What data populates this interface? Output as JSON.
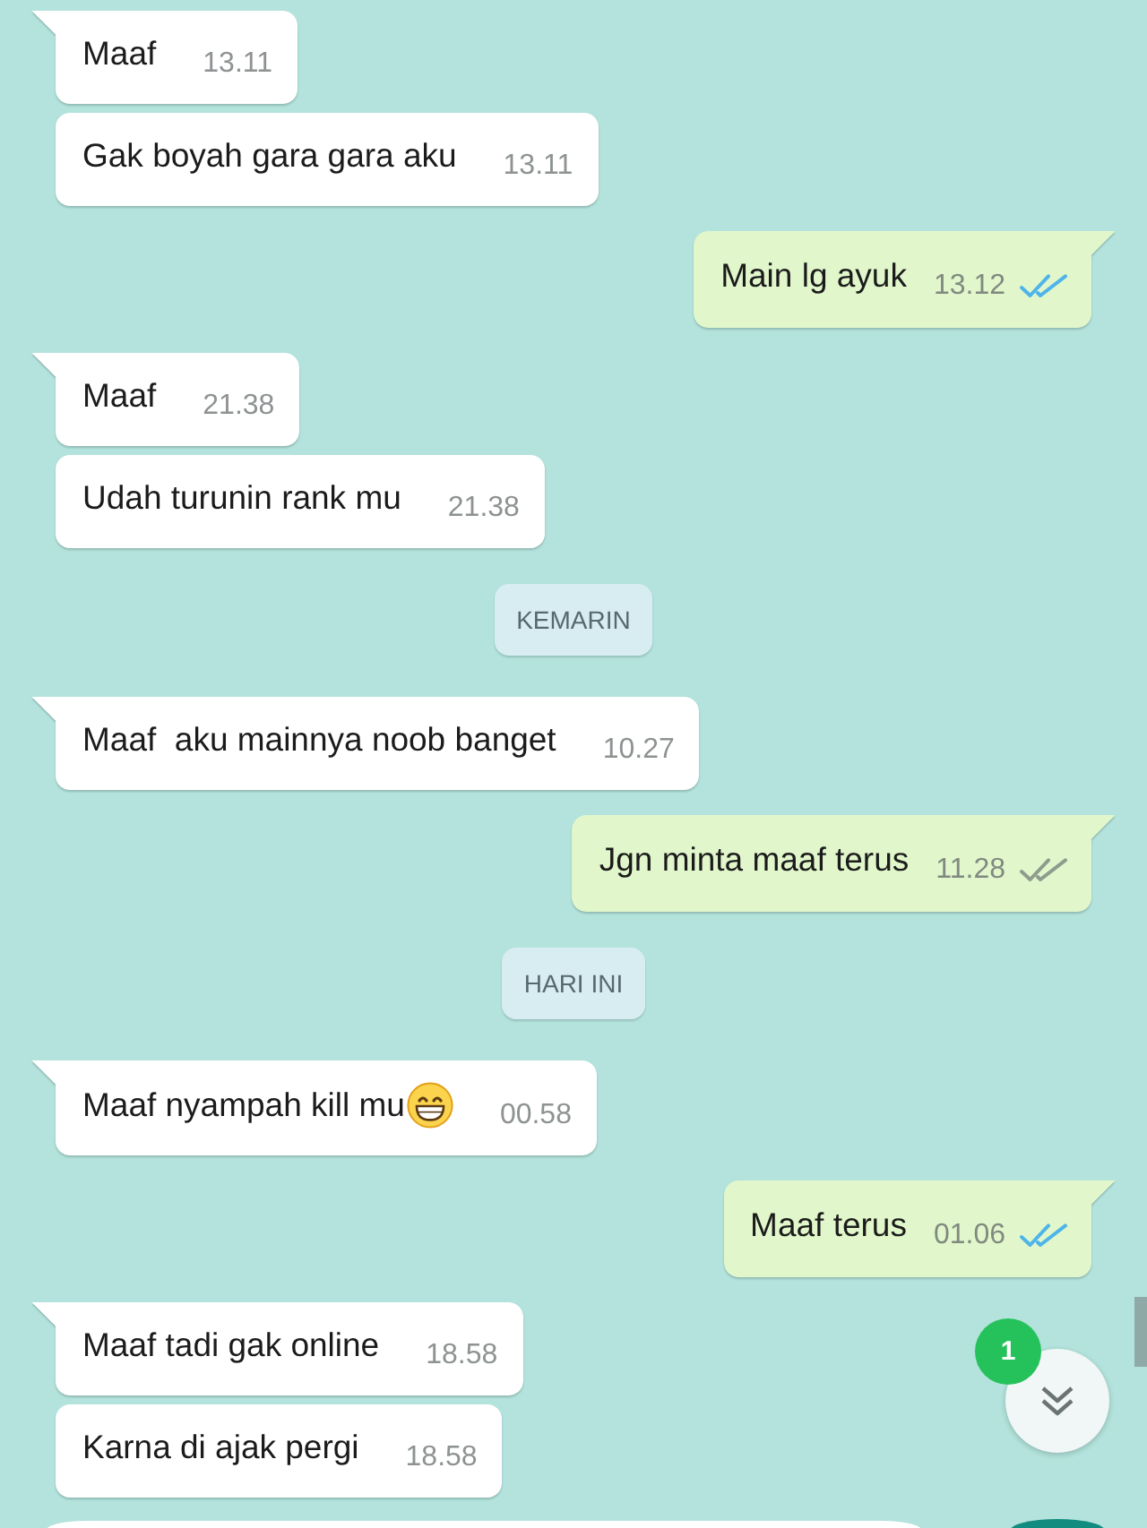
{
  "messages": [
    {
      "kind": "message",
      "outgoing": false,
      "tail": true,
      "text": "Maaf",
      "time": "13.11"
    },
    {
      "kind": "message",
      "outgoing": false,
      "tail": false,
      "text": "Gak boyah gara gara aku",
      "time": "13.11"
    },
    {
      "kind": "message",
      "outgoing": true,
      "tail": true,
      "text": "Main lg ayuk",
      "time": "13.12",
      "read": true
    },
    {
      "kind": "message",
      "outgoing": false,
      "tail": true,
      "text": "Maaf",
      "time": "21.38"
    },
    {
      "kind": "message",
      "outgoing": false,
      "tail": false,
      "text": "Udah turunin rank mu",
      "time": "21.38"
    },
    {
      "kind": "date",
      "label": "KEMARIN"
    },
    {
      "kind": "message",
      "outgoing": false,
      "tail": true,
      "text": "Maaf  aku mainnya noob banget",
      "time": "10.27"
    },
    {
      "kind": "message",
      "outgoing": true,
      "tail": true,
      "text": "Jgn minta maaf terus",
      "time": "11.28",
      "read": false
    },
    {
      "kind": "date",
      "label": "HARI INI"
    },
    {
      "kind": "message",
      "outgoing": false,
      "tail": true,
      "text": "Maaf nyampah kill mu",
      "emoji": true,
      "time": "00.58"
    },
    {
      "kind": "message",
      "outgoing": true,
      "tail": true,
      "text": "Maaf terus",
      "time": "01.06",
      "read": true
    },
    {
      "kind": "message",
      "outgoing": false,
      "tail": true,
      "text": "Maaf tadi gak online",
      "time": "18.58"
    },
    {
      "kind": "message",
      "outgoing": false,
      "tail": false,
      "text": "Karna di ajak pergi",
      "time": "18.58"
    }
  ],
  "scroll_button": {
    "unread_count": "1"
  }
}
